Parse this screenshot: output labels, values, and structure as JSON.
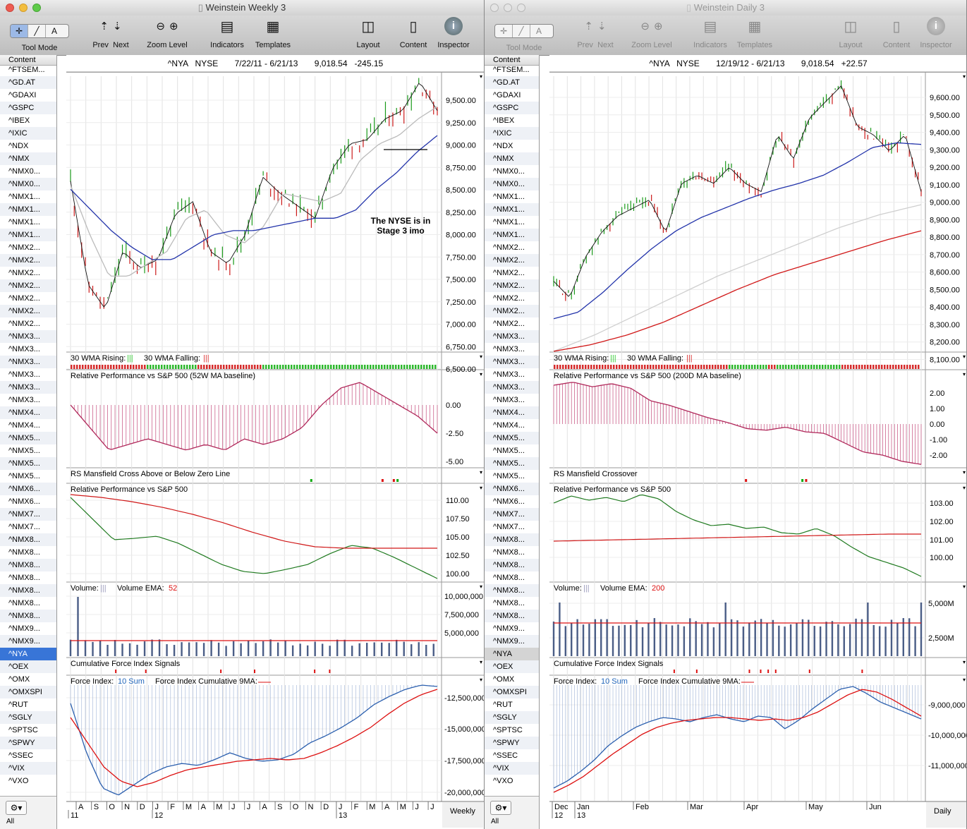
{
  "left": {
    "window_title": "Weinstein Weekly 3",
    "toolbar": {
      "tool_mode": "Tool Mode",
      "prev": "Prev",
      "next": "Next",
      "zoom": "Zoom",
      "level": "Level",
      "indicators": "Indicators",
      "templates": "Templates",
      "layout": "Layout",
      "content": "Content",
      "inspector": "Inspector"
    },
    "sidebar_header": "Content",
    "header": {
      "symbol": "^NYA",
      "exchange": "NYSE",
      "range": "7/22/11 - 6/21/13",
      "last": "9,018.54",
      "change": "-245.15"
    },
    "annotation": [
      "The NYSE is in",
      "Stage 3 imo"
    ],
    "period_label": "Weekly"
  },
  "right": {
    "window_title": "Weinstein Daily 3",
    "header": {
      "symbol": "^NYA",
      "exchange": "NYSE",
      "range": "12/19/12 - 6/21/13",
      "last": "9,018.54",
      "change": "+22.57"
    },
    "period_label": "Daily"
  },
  "sidebar_items": [
    "^FTSEM...",
    "^GD.AT",
    "^GDAXI",
    "^GSPC",
    "^IBEX",
    "^IXIC",
    "^NDX",
    "^NMX",
    "^NMX0...",
    "^NMX0...",
    "^NMX1...",
    "^NMX1...",
    "^NMX1...",
    "^NMX1...",
    "^NMX2...",
    "^NMX2...",
    "^NMX2...",
    "^NMX2...",
    "^NMX2...",
    "^NMX2...",
    "^NMX2...",
    "^NMX3...",
    "^NMX3...",
    "^NMX3...",
    "^NMX3...",
    "^NMX3...",
    "^NMX3...",
    "^NMX4...",
    "^NMX4...",
    "^NMX5...",
    "^NMX5...",
    "^NMX5...",
    "^NMX5...",
    "^NMX6...",
    "^NMX6...",
    "^NMX7...",
    "^NMX7...",
    "^NMX8...",
    "^NMX8...",
    "^NMX8...",
    "^NMX8...",
    "^NMX8...",
    "^NMX8...",
    "^NMX8...",
    "^NMX9...",
    "^NMX9...",
    "^NYA",
    "^OEX",
    "^OMX",
    "^OMXSPI",
    "^RUT",
    "^SGLY",
    "^SPTSC",
    "^SPWY",
    "^SSEC",
    "^VIX",
    "^VXO"
  ],
  "selected_item": "^NYA",
  "sidebar_footer": "All",
  "panels": {
    "wma": {
      "rising": "30 WMA Rising:",
      "falling": "30 WMA Falling:"
    },
    "left_rp_title": "Relative Performance vs S&P 500 (52W MA baseline)",
    "right_rp_title": "Relative Performance vs S&P 500 (200D MA baseline)",
    "left_cross_title": "RS Mansfield Cross Above or Below Zero Line",
    "right_cross_title": "RS Mansfield Crossover",
    "rp2_title": "Relative Performance vs S&P 500",
    "volume": "Volume:",
    "volume_ema": "Volume EMA:",
    "left_ema_period": "52",
    "right_ema_period": "200",
    "cfi_title": "Cumulative Force Index Signals",
    "force_index": "Force Index:",
    "force_sum": "10 Sum",
    "force_cum": "Force Index Cumulative 9MA:"
  },
  "axes": {
    "left_price": [
      "9,500.00",
      "9,250.00",
      "9,000.00",
      "8,750.00",
      "8,500.00",
      "8,250.00",
      "8,000.00",
      "7,750.00",
      "7,500.00",
      "7,250.00",
      "7,000.00",
      "6,750.00",
      "6,500.00"
    ],
    "right_price": [
      "9,600.00",
      "9,500.00",
      "9,400.00",
      "9,300.00",
      "9,200.00",
      "9,100.00",
      "9,000.00",
      "8,900.00",
      "8,800.00",
      "8,700.00",
      "8,600.00",
      "8,500.00",
      "8,400.00",
      "8,300.00",
      "8,200.00",
      "8,100.00"
    ],
    "left_rp": [
      "0.00",
      "-2.50",
      "-5.00"
    ],
    "right_rp": [
      "2.00",
      "1.00",
      "0.00",
      "-1.00",
      "-2.00"
    ],
    "left_rp2": [
      "110.00",
      "107.50",
      "105.00",
      "102.50",
      "100.00"
    ],
    "right_rp2": [
      "103.00",
      "102.00",
      "101.00",
      "100.00"
    ],
    "left_vol": [
      "10,000,000",
      "7,500,000",
      "5,000,000"
    ],
    "right_vol": [
      "5,000M",
      "2,500M"
    ],
    "left_force": [
      "-12,500,000",
      "-15,000,000",
      "-17,500,000",
      "-20,000,000"
    ],
    "right_force": [
      "-9,000,000",
      "-10,000,000",
      "-11,000,000"
    ],
    "left_months": [
      "A",
      "S",
      "O",
      "N",
      "D",
      "J",
      "F",
      "M",
      "A",
      "M",
      "J",
      "J",
      "A",
      "S",
      "O",
      "N",
      "D",
      "J",
      "F",
      "M",
      "A",
      "M",
      "J",
      "J"
    ],
    "left_years": [
      "11",
      "12",
      "13"
    ],
    "right_months": [
      "Dec",
      "Jan",
      "Feb",
      "Mar",
      "Apr",
      "May",
      "Jun"
    ],
    "right_years": [
      "12",
      "13"
    ]
  }
}
